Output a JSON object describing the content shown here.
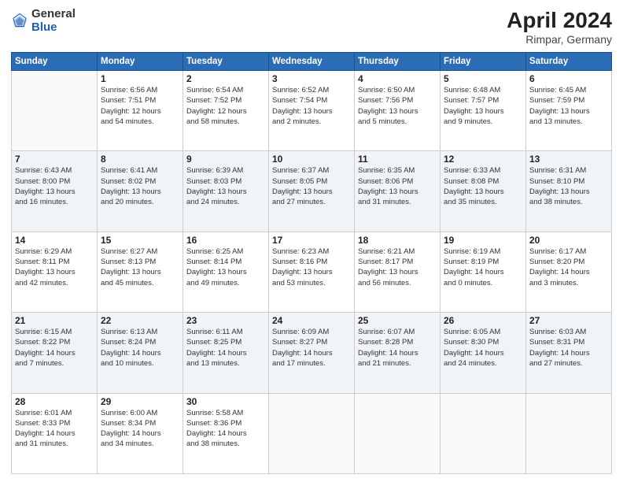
{
  "logo": {
    "general": "General",
    "blue": "Blue"
  },
  "title": "April 2024",
  "location": "Rimpar, Germany",
  "days_of_week": [
    "Sunday",
    "Monday",
    "Tuesday",
    "Wednesday",
    "Thursday",
    "Friday",
    "Saturday"
  ],
  "weeks": [
    [
      {
        "day": "",
        "info": ""
      },
      {
        "day": "1",
        "info": "Sunrise: 6:56 AM\nSunset: 7:51 PM\nDaylight: 12 hours\nand 54 minutes."
      },
      {
        "day": "2",
        "info": "Sunrise: 6:54 AM\nSunset: 7:52 PM\nDaylight: 12 hours\nand 58 minutes."
      },
      {
        "day": "3",
        "info": "Sunrise: 6:52 AM\nSunset: 7:54 PM\nDaylight: 13 hours\nand 2 minutes."
      },
      {
        "day": "4",
        "info": "Sunrise: 6:50 AM\nSunset: 7:56 PM\nDaylight: 13 hours\nand 5 minutes."
      },
      {
        "day": "5",
        "info": "Sunrise: 6:48 AM\nSunset: 7:57 PM\nDaylight: 13 hours\nand 9 minutes."
      },
      {
        "day": "6",
        "info": "Sunrise: 6:45 AM\nSunset: 7:59 PM\nDaylight: 13 hours\nand 13 minutes."
      }
    ],
    [
      {
        "day": "7",
        "info": "Sunrise: 6:43 AM\nSunset: 8:00 PM\nDaylight: 13 hours\nand 16 minutes."
      },
      {
        "day": "8",
        "info": "Sunrise: 6:41 AM\nSunset: 8:02 PM\nDaylight: 13 hours\nand 20 minutes."
      },
      {
        "day": "9",
        "info": "Sunrise: 6:39 AM\nSunset: 8:03 PM\nDaylight: 13 hours\nand 24 minutes."
      },
      {
        "day": "10",
        "info": "Sunrise: 6:37 AM\nSunset: 8:05 PM\nDaylight: 13 hours\nand 27 minutes."
      },
      {
        "day": "11",
        "info": "Sunrise: 6:35 AM\nSunset: 8:06 PM\nDaylight: 13 hours\nand 31 minutes."
      },
      {
        "day": "12",
        "info": "Sunrise: 6:33 AM\nSunset: 8:08 PM\nDaylight: 13 hours\nand 35 minutes."
      },
      {
        "day": "13",
        "info": "Sunrise: 6:31 AM\nSunset: 8:10 PM\nDaylight: 13 hours\nand 38 minutes."
      }
    ],
    [
      {
        "day": "14",
        "info": "Sunrise: 6:29 AM\nSunset: 8:11 PM\nDaylight: 13 hours\nand 42 minutes."
      },
      {
        "day": "15",
        "info": "Sunrise: 6:27 AM\nSunset: 8:13 PM\nDaylight: 13 hours\nand 45 minutes."
      },
      {
        "day": "16",
        "info": "Sunrise: 6:25 AM\nSunset: 8:14 PM\nDaylight: 13 hours\nand 49 minutes."
      },
      {
        "day": "17",
        "info": "Sunrise: 6:23 AM\nSunset: 8:16 PM\nDaylight: 13 hours\nand 53 minutes."
      },
      {
        "day": "18",
        "info": "Sunrise: 6:21 AM\nSunset: 8:17 PM\nDaylight: 13 hours\nand 56 minutes."
      },
      {
        "day": "19",
        "info": "Sunrise: 6:19 AM\nSunset: 8:19 PM\nDaylight: 14 hours\nand 0 minutes."
      },
      {
        "day": "20",
        "info": "Sunrise: 6:17 AM\nSunset: 8:20 PM\nDaylight: 14 hours\nand 3 minutes."
      }
    ],
    [
      {
        "day": "21",
        "info": "Sunrise: 6:15 AM\nSunset: 8:22 PM\nDaylight: 14 hours\nand 7 minutes."
      },
      {
        "day": "22",
        "info": "Sunrise: 6:13 AM\nSunset: 8:24 PM\nDaylight: 14 hours\nand 10 minutes."
      },
      {
        "day": "23",
        "info": "Sunrise: 6:11 AM\nSunset: 8:25 PM\nDaylight: 14 hours\nand 13 minutes."
      },
      {
        "day": "24",
        "info": "Sunrise: 6:09 AM\nSunset: 8:27 PM\nDaylight: 14 hours\nand 17 minutes."
      },
      {
        "day": "25",
        "info": "Sunrise: 6:07 AM\nSunset: 8:28 PM\nDaylight: 14 hours\nand 21 minutes."
      },
      {
        "day": "26",
        "info": "Sunrise: 6:05 AM\nSunset: 8:30 PM\nDaylight: 14 hours\nand 24 minutes."
      },
      {
        "day": "27",
        "info": "Sunrise: 6:03 AM\nSunset: 8:31 PM\nDaylight: 14 hours\nand 27 minutes."
      }
    ],
    [
      {
        "day": "28",
        "info": "Sunrise: 6:01 AM\nSunset: 8:33 PM\nDaylight: 14 hours\nand 31 minutes."
      },
      {
        "day": "29",
        "info": "Sunrise: 6:00 AM\nSunset: 8:34 PM\nDaylight: 14 hours\nand 34 minutes."
      },
      {
        "day": "30",
        "info": "Sunrise: 5:58 AM\nSunset: 8:36 PM\nDaylight: 14 hours\nand 38 minutes."
      },
      {
        "day": "",
        "info": ""
      },
      {
        "day": "",
        "info": ""
      },
      {
        "day": "",
        "info": ""
      },
      {
        "day": "",
        "info": ""
      }
    ]
  ]
}
